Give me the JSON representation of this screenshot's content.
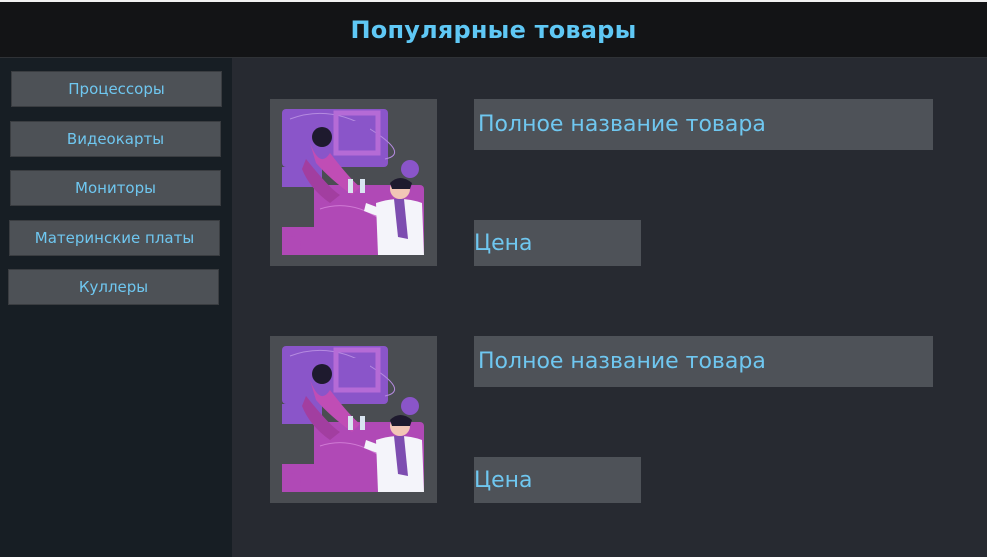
{
  "header": {
    "title": "Популярные товары"
  },
  "sidebar": {
    "items": [
      {
        "label": "Процессоры"
      },
      {
        "label": "Видеокарты"
      },
      {
        "label": "Мониторы"
      },
      {
        "label": "Материнские платы"
      },
      {
        "label": "Куллеры"
      }
    ]
  },
  "products": [
    {
      "name": "Полное название товара",
      "price": "Цена",
      "image_icon": "people-toasting-illustration"
    },
    {
      "name": "Полное название товара",
      "price": "Цена",
      "image_icon": "people-toasting-illustration"
    }
  ],
  "colors": {
    "accent": "#6fc7f0",
    "header_bg": "#131416",
    "sidebar_bg": "#171e24",
    "main_bg": "#272a31",
    "button_bg": "#4d5156"
  }
}
